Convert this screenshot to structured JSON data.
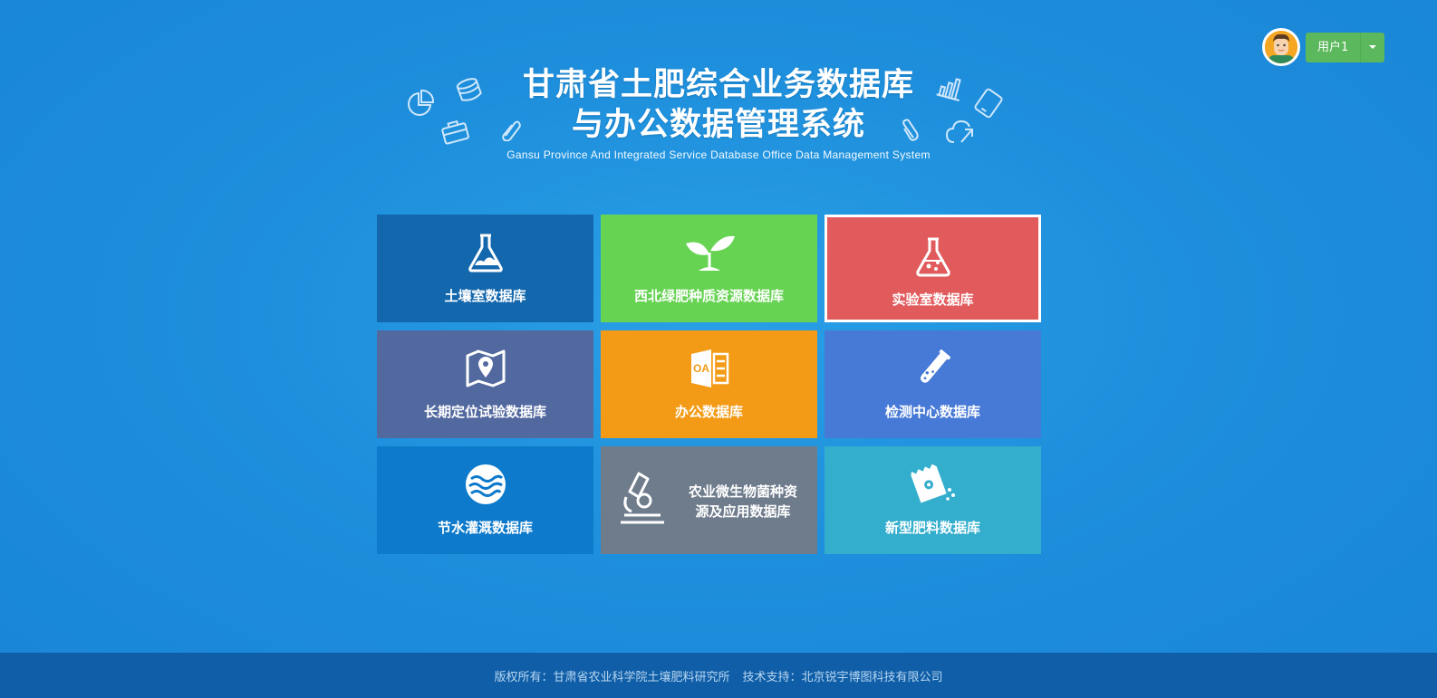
{
  "user": {
    "name": "用户1",
    "avatar_color": "#f5a623"
  },
  "header": {
    "title_line1": "甘肃省土肥综合业务数据库",
    "title_line2": "与办公数据管理系统",
    "subtitle": "Gansu Province And Integrated Service Database Office Data Management System"
  },
  "tiles": [
    {
      "label": "土壤室数据库",
      "color": "#1367ad",
      "icon": "flask-icon"
    },
    {
      "label": "西北绿肥种质资源数据库",
      "color": "#67d353",
      "icon": "sprout-icon"
    },
    {
      "label": "实验室数据库",
      "color": "#e15b5d",
      "icon": "lab-flask-icon"
    },
    {
      "label": "长期定位试验数据库",
      "color": "#52699f",
      "icon": "map-pin-icon"
    },
    {
      "label": "办公数据库",
      "color": "#f39b16",
      "icon": "oa-icon"
    },
    {
      "label": "检测中心数据库",
      "color": "#477ad6",
      "icon": "test-tube-icon"
    },
    {
      "label": "节水灌溉数据库",
      "color": "#0d7acb",
      "icon": "water-icon"
    },
    {
      "label": "农业微生物菌种资源及应用数据库",
      "color": "#6f7c8c",
      "icon": "microscope-icon"
    },
    {
      "label": "新型肥料数据库",
      "color": "#33aecd",
      "icon": "fertilizer-bag-icon"
    }
  ],
  "tile8_lines": [
    "农业微生物菌种资",
    "源及应用数据库"
  ],
  "footer": {
    "copyright": "版权所有：甘肃省农业科学院土壤肥料研究所",
    "support": "技术支持：北京锐宇博图科技有限公司"
  }
}
